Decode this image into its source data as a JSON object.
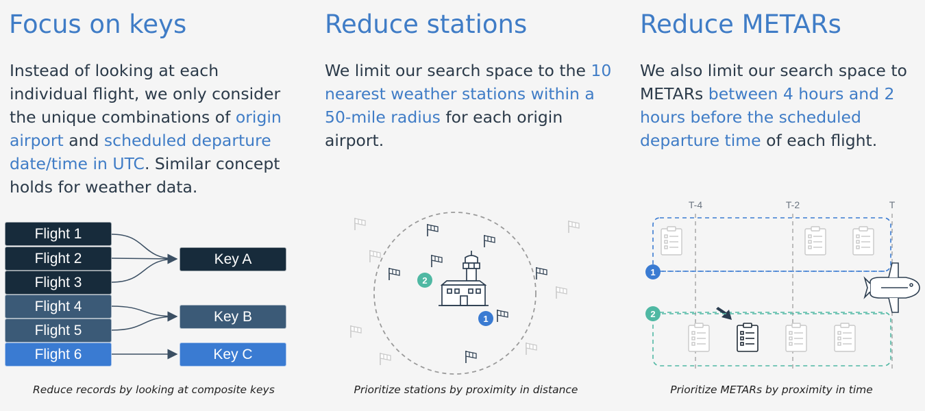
{
  "columns": [
    {
      "heading": "Focus on keys",
      "body": [
        {
          "t": "Instead of looking at each individual flight, we only consider the unique combinations of ",
          "h": false
        },
        {
          "t": "origin airport",
          "h": true
        },
        {
          "t": " and ",
          "h": false
        },
        {
          "t": "scheduled departure date/time in UTC",
          "h": true
        },
        {
          "t": ". Similar concept holds for weather data.",
          "h": false
        }
      ],
      "caption": "Reduce records by looking at composite keys"
    },
    {
      "heading": "Reduce stations",
      "body": [
        {
          "t": "We limit our search space to the ",
          "h": false
        },
        {
          "t": "10 nearest weather stations within a 50-mile radius",
          "h": true
        },
        {
          "t": " for each origin airport.",
          "h": false
        }
      ],
      "caption": "Prioritize stations by proximity in distance"
    },
    {
      "heading": "Reduce METARs",
      "body": [
        {
          "t": "We also limit our search space to METARs ",
          "h": false
        },
        {
          "t": "between 4 hours and 2 hours before the scheduled departure time",
          "h": true
        },
        {
          "t": " of each flight.",
          "h": false
        }
      ],
      "caption": "Prioritize METARs by proximity in time"
    }
  ],
  "keys_diagram": {
    "flights": [
      "Flight 1",
      "Flight 2",
      "Flight 3",
      "Flight 4",
      "Flight 5",
      "Flight 6"
    ],
    "keys": [
      "Key A",
      "Key B",
      "Key C"
    ],
    "mapping": {
      "Flight 1": "Key A",
      "Flight 2": "Key A",
      "Flight 3": "Key A",
      "Flight 4": "Key B",
      "Flight 5": "Key B",
      "Flight 6": "Key C"
    }
  },
  "stations_diagram": {
    "badges": [
      "1",
      "2"
    ]
  },
  "metars_diagram": {
    "time_labels": [
      "T-4",
      "T-2",
      "T"
    ],
    "badges": [
      "1",
      "2"
    ]
  },
  "colors": {
    "accent": "#3f7cc6",
    "dark_box": "#172b3b",
    "mid_box": "#3b5a77",
    "blue_box": "#3a7bd2",
    "badge_blue": "#3a7bd2",
    "badge_teal": "#4fb8a3"
  }
}
